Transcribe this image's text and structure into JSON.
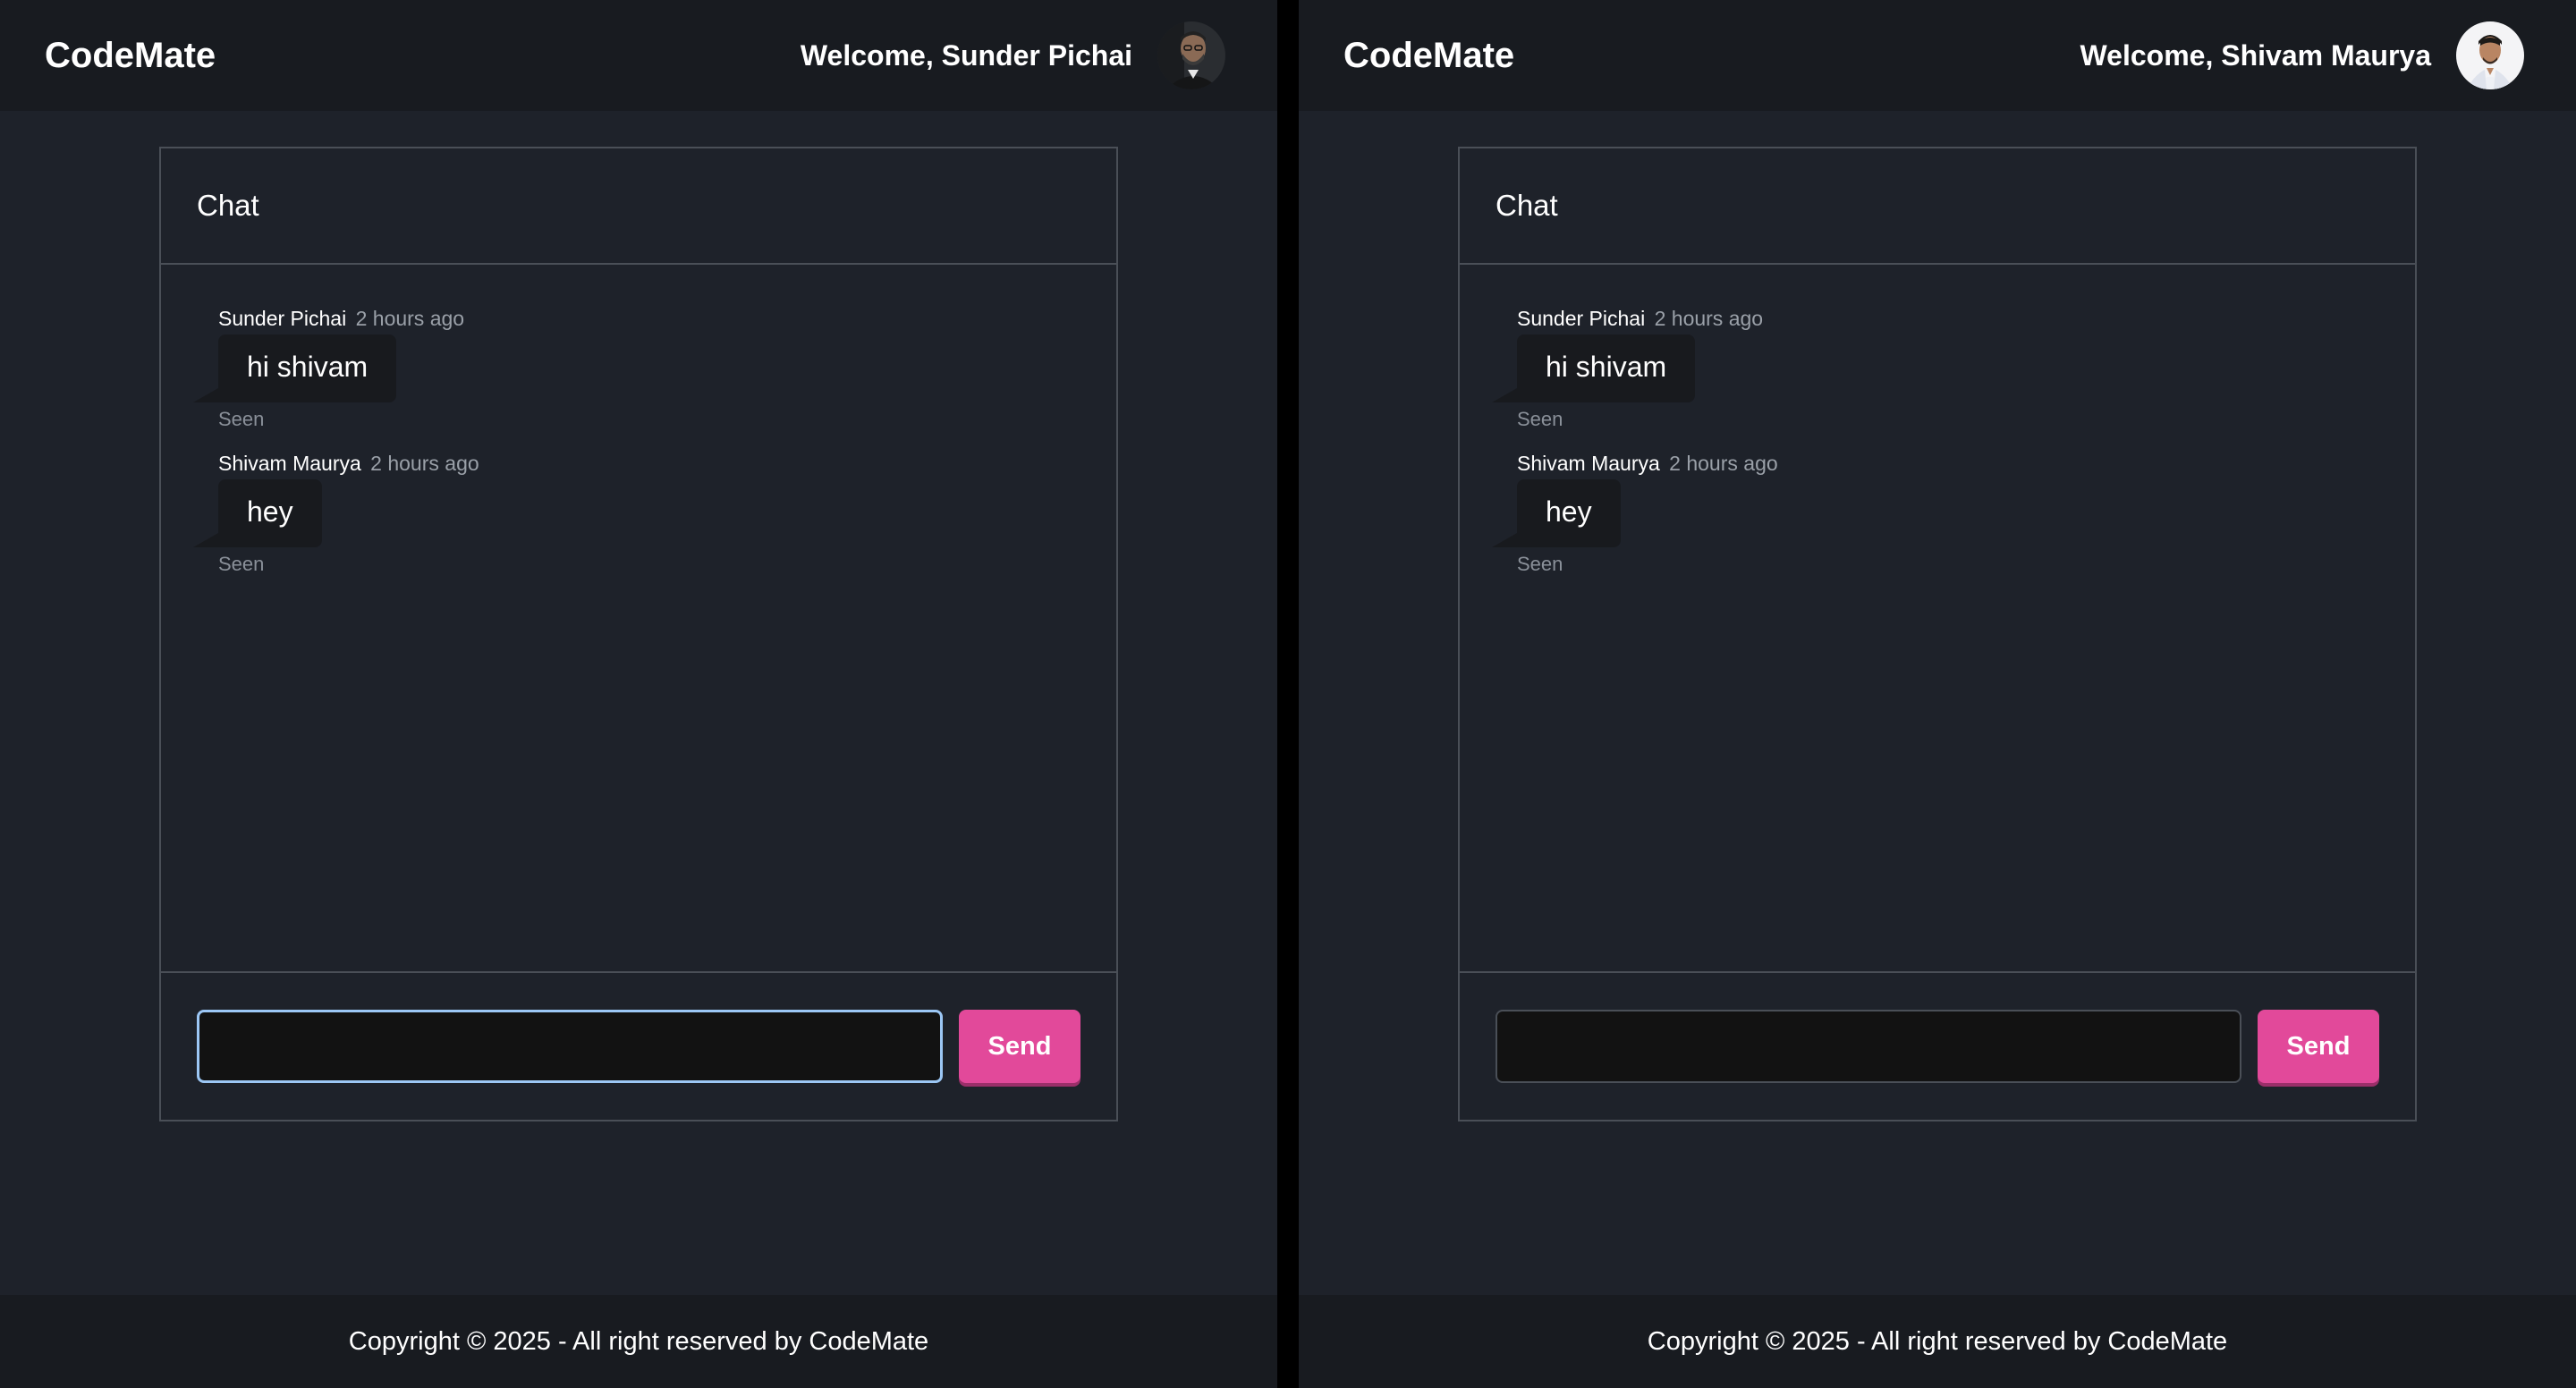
{
  "panes": [
    {
      "brand": "CodeMate",
      "welcome": "Welcome, Sunder Pichai",
      "avatar_icon": "user-photo-avatar",
      "chat_title": "Chat",
      "messages": [
        {
          "author": "Sunder Pichai",
          "time": "2 hours ago",
          "text": "hi shivam",
          "status": "Seen"
        },
        {
          "author": "Shivam Maurya",
          "time": "2 hours ago",
          "text": "hey",
          "status": "Seen"
        }
      ],
      "input_value": "",
      "input_focused": true,
      "send_label": "Send",
      "footer": "Copyright © 2025 - All right reserved by CodeMate"
    },
    {
      "brand": "CodeMate",
      "welcome": "Welcome, Shivam Maurya",
      "avatar_icon": "user-photo-avatar",
      "chat_title": "Chat",
      "messages": [
        {
          "author": "Sunder Pichai",
          "time": "2 hours ago",
          "text": "hi shivam",
          "status": "Seen"
        },
        {
          "author": "Shivam Maurya",
          "time": "2 hours ago",
          "text": "hey",
          "status": "Seen"
        }
      ],
      "input_value": "",
      "input_focused": false,
      "send_label": "Send",
      "footer": "Copyright © 2025 - All right reserved by CodeMate"
    }
  ],
  "colors": {
    "background": "#1e222a",
    "navbar": "#181b20",
    "bubble": "#181a1e",
    "accent": "#e2499a",
    "focus_ring": "#9cc7f5"
  }
}
